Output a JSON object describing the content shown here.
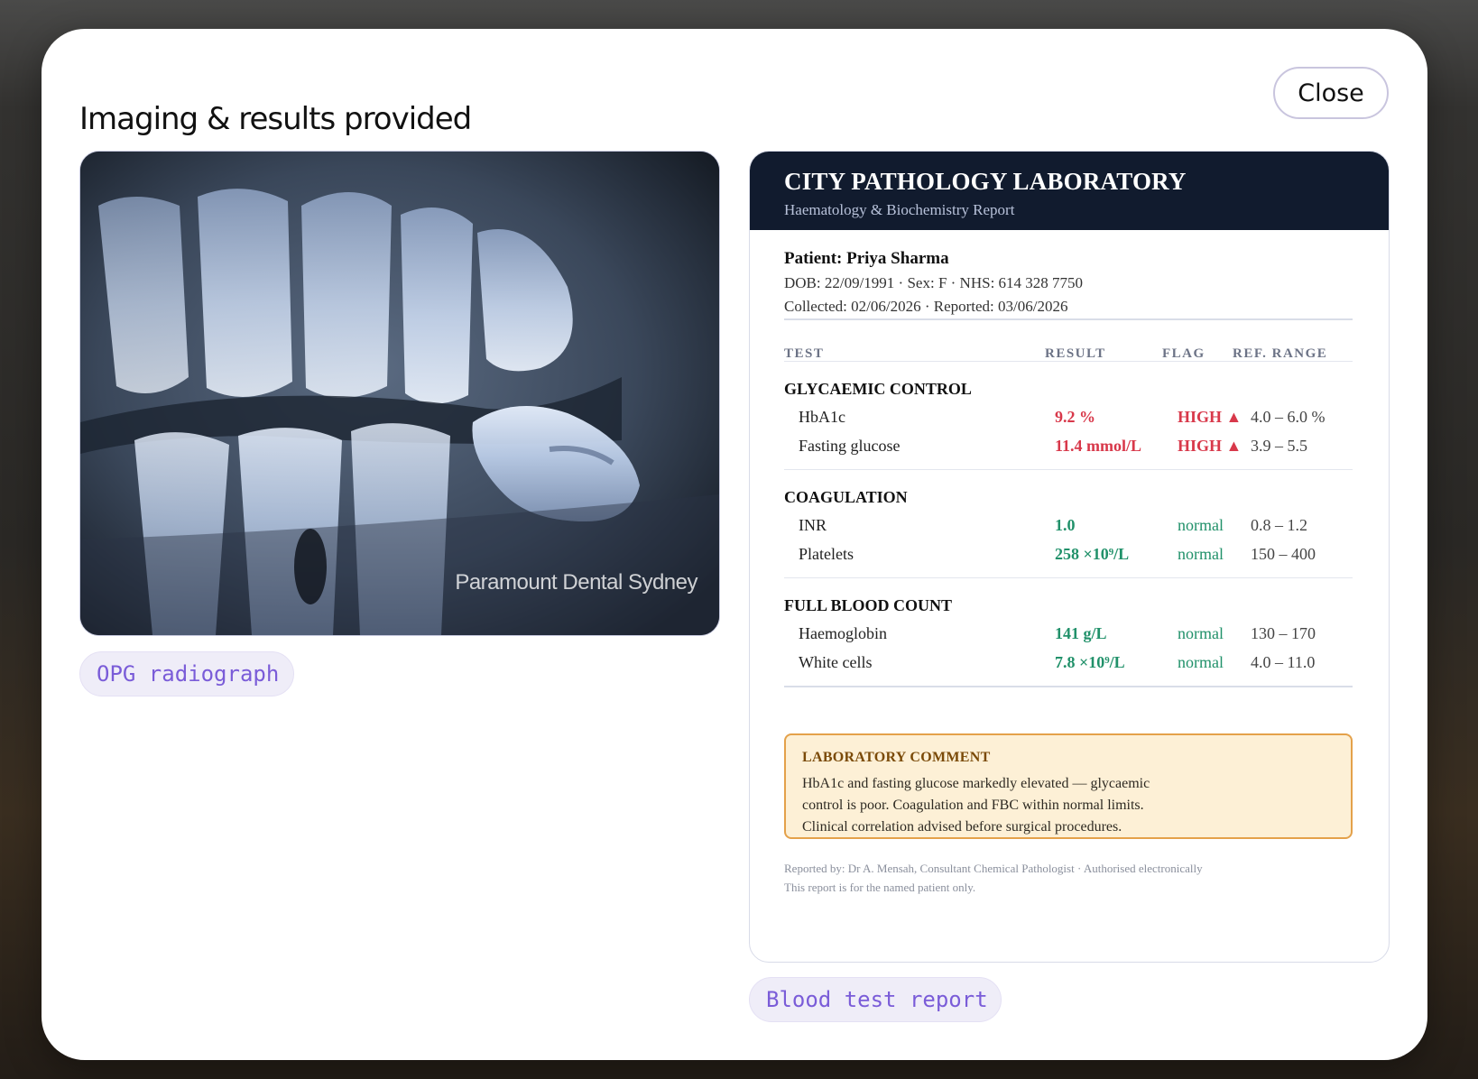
{
  "modal": {
    "title": "Imaging & results provided",
    "close_label": "Close"
  },
  "xray": {
    "watermark": "Paramount Dental Sydney",
    "caption": "OPG radiograph"
  },
  "report": {
    "lab_name": "CITY PATHOLOGY LABORATORY",
    "lab_subtitle": "Haematology & Biochemistry Report",
    "patient_name": "Patient: Priya Sharma",
    "patient_details": "DOB: 22/09/1991 · Sex: F · NHS: 614 328 7750",
    "dates": "Collected: 02/06/2026 · Reported: 03/06/2026",
    "columns": [
      "TEST",
      "RESULT",
      "FLAG",
      "REF. RANGE"
    ],
    "sections": [
      {
        "title": "GLYCAEMIC CONTROL",
        "rows": [
          {
            "test": "HbA1c",
            "result": "9.2 %",
            "flag": "HIGH ▲",
            "ref": "4.0 – 6.0 %",
            "status": "high"
          },
          {
            "test": "Fasting glucose",
            "result": "11.4 mmol/L",
            "flag": "HIGH ▲",
            "ref": "3.9 – 5.5",
            "status": "high"
          }
        ]
      },
      {
        "title": "COAGULATION",
        "rows": [
          {
            "test": "INR",
            "result": "1.0",
            "flag": "normal",
            "ref": "0.8 – 1.2",
            "status": "normal"
          },
          {
            "test": "Platelets",
            "result": "258 ×10⁹/L",
            "flag": "normal",
            "ref": "150 – 400",
            "status": "normal"
          }
        ]
      },
      {
        "title": "FULL BLOOD COUNT",
        "rows": [
          {
            "test": "Haemoglobin",
            "result": "141 g/L",
            "flag": "normal",
            "ref": "130 – 170",
            "status": "normal"
          },
          {
            "test": "White cells",
            "result": "7.8 ×10⁹/L",
            "flag": "normal",
            "ref": "4.0 – 11.0",
            "status": "normal"
          }
        ]
      }
    ],
    "comment": {
      "title": "LABORATORY COMMENT",
      "lines": [
        "HbA1c and fasting glucose markedly elevated — glycaemic",
        "control is poor. Coagulation and FBC within normal limits.",
        "Clinical correlation advised before surgical procedures."
      ]
    },
    "footer": [
      "Reported by: Dr A. Mensah, Consultant Chemical Pathologist · Authorised electronically",
      "This report is for the named patient only."
    ],
    "caption": "Blood test report"
  },
  "colors": {
    "high": "#d8384a",
    "normal": "#21916a",
    "header_bg": "#111b2e",
    "tag_text": "#7a5cd8",
    "comment_bg": "#fdf0d6",
    "comment_border": "#e4a14a"
  }
}
